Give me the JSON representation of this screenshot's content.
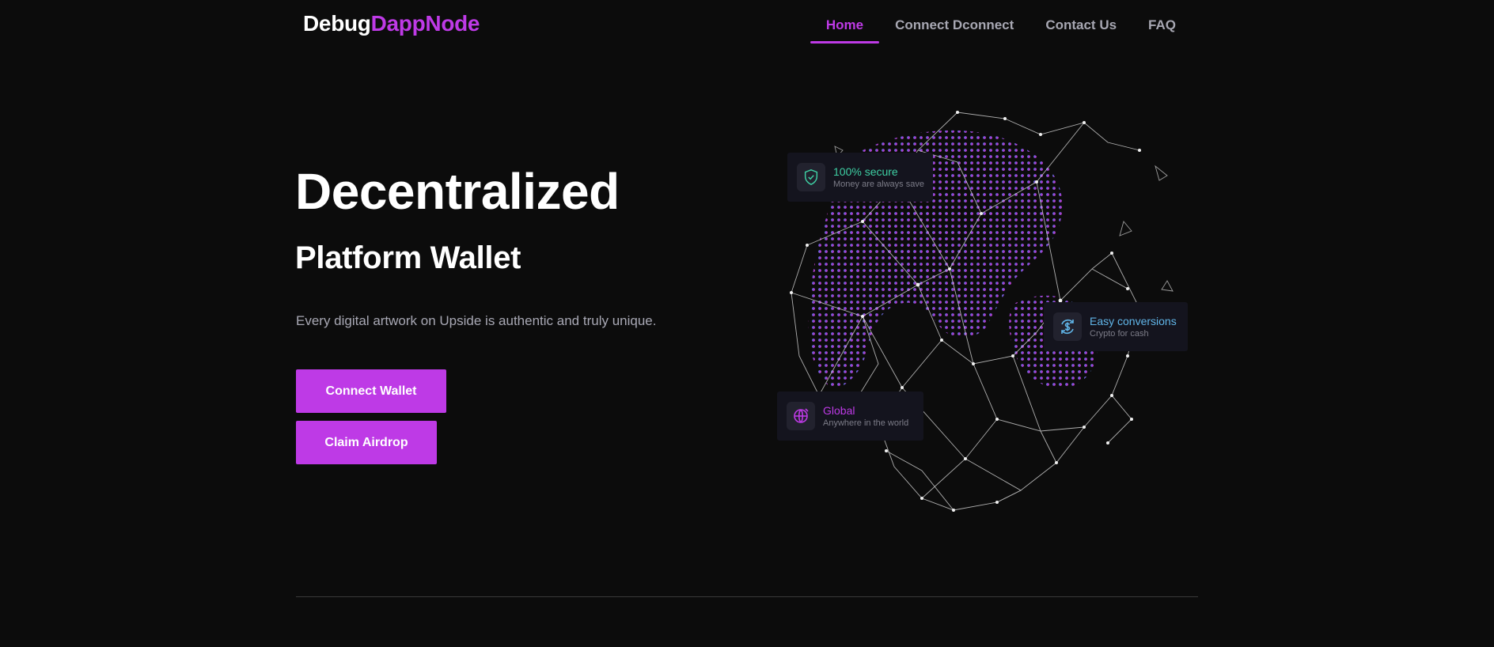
{
  "brand": {
    "name_part1": "Debug",
    "name_part2": "DappNode",
    "accent_color": "#be3ae6"
  },
  "nav": {
    "items": [
      {
        "label": "Home",
        "active": true
      },
      {
        "label": "Connect Dconnect",
        "active": false
      },
      {
        "label": "Contact Us",
        "active": false
      },
      {
        "label": "FAQ",
        "active": false
      }
    ]
  },
  "hero": {
    "title": "Decentralized",
    "subtitle": "Platform Wallet",
    "description": "Every digital artwork on Upside is authentic and truly unique.",
    "buttons": {
      "connect_wallet": "Connect Wallet",
      "claim_airdrop": "Claim Airdrop"
    }
  },
  "globe": {
    "cards": {
      "secure": {
        "title": "100% secure",
        "subtitle": "Money are always save",
        "icon": "shield-check-icon",
        "color": "#3ecfa3"
      },
      "conversions": {
        "title": "Easy conversions",
        "subtitle": "Crypto for cash",
        "icon": "dollar-exchange-icon",
        "color": "#60b5e8"
      },
      "global": {
        "title": "Global",
        "subtitle": "Anywhere in the world",
        "icon": "globe-coin-icon",
        "color": "#be3ae6"
      }
    }
  }
}
